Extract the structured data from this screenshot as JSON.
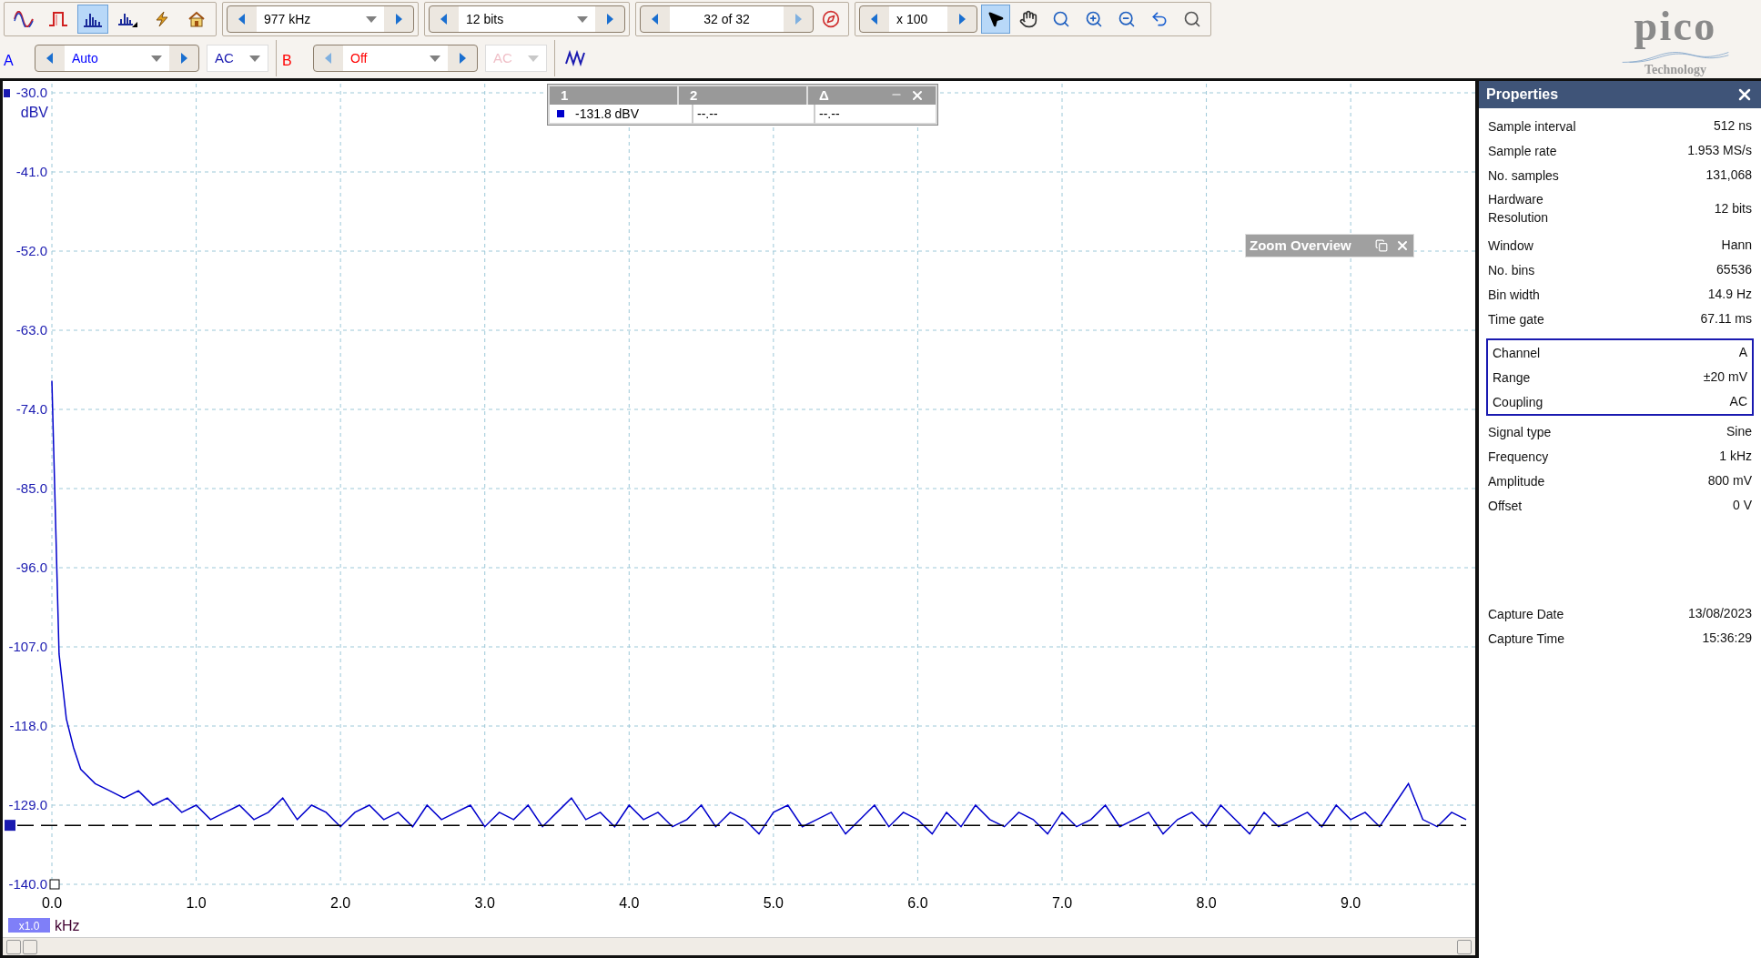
{
  "toolbar": {
    "mode_buttons": [
      {
        "kind": "scope",
        "selected": false
      },
      {
        "kind": "persistence",
        "selected": false
      },
      {
        "kind": "spectrum",
        "selected": true
      },
      {
        "kind": "spectrum_options",
        "selected": false
      },
      {
        "kind": "triggers",
        "selected": false
      },
      {
        "kind": "home",
        "selected": false
      }
    ],
    "collection": {
      "value": "977 kHz"
    },
    "resolution": {
      "value": "12 bits"
    },
    "buffer": {
      "value": "32 of 32"
    },
    "zoom": {
      "value": "x 100"
    },
    "tools": [
      {
        "kind": "pointer",
        "selected": true
      },
      {
        "kind": "hand",
        "selected": false
      },
      {
        "kind": "zoom_area",
        "selected": false
      },
      {
        "kind": "zoom_in",
        "selected": false
      },
      {
        "kind": "zoom_out",
        "selected": false
      },
      {
        "kind": "undo",
        "selected": false
      },
      {
        "kind": "zoom_100",
        "selected": false
      }
    ]
  },
  "channels": [
    {
      "label": "A",
      "range": "Auto",
      "coupling": "AC",
      "enabled": true,
      "color": "#0000ff"
    },
    {
      "label": "B",
      "range": "Off",
      "coupling": "AC",
      "enabled": false,
      "color": "#ff0000"
    }
  ],
  "logo": {
    "name": "pico",
    "tagline": "Technology"
  },
  "graph": {
    "y_unit": "dBV",
    "x_unit": "kHz",
    "x_scale": "x1.0",
    "chart_data": {
      "type": "line",
      "grid": true,
      "ref_lines": [
        {
          "axis": "y",
          "value": -131.8
        }
      ],
      "xlim": [
        0,
        9.8
      ],
      "ylim": [
        -140,
        -30
      ],
      "xticks": [
        {
          "value": 0,
          "label": "0.0"
        },
        {
          "value": 1,
          "label": "1.0"
        },
        {
          "value": 2,
          "label": "2.0"
        },
        {
          "value": 3,
          "label": "3.0"
        },
        {
          "value": 4,
          "label": "4.0"
        },
        {
          "value": 5,
          "label": "5.0"
        },
        {
          "value": 6,
          "label": "6.0"
        },
        {
          "value": 7,
          "label": "7.0"
        },
        {
          "value": 8,
          "label": "8.0"
        },
        {
          "value": 9,
          "label": "9.0"
        }
      ],
      "yticks": [
        {
          "value": -30,
          "label": "-30.0"
        },
        {
          "value": -41,
          "label": "-41.0"
        },
        {
          "value": -52,
          "label": "-52.0"
        },
        {
          "value": -63,
          "label": "-63.0"
        },
        {
          "value": -74,
          "label": "-74.0"
        },
        {
          "value": -85,
          "label": "-85.0"
        },
        {
          "value": -96,
          "label": "-96.0"
        },
        {
          "value": -107,
          "label": "-107.0"
        },
        {
          "value": -118,
          "label": "-118.0"
        },
        {
          "value": -129,
          "label": "-129.0"
        },
        {
          "value": -140,
          "label": "-140.0"
        }
      ],
      "x": [
        0,
        0.05,
        0.1,
        0.15,
        0.2,
        0.3,
        0.4,
        0.5,
        0.6,
        0.7,
        0.8,
        0.9,
        1.0,
        1.1,
        1.2,
        1.3,
        1.4,
        1.5,
        1.6,
        1.7,
        1.8,
        1.9,
        2.0,
        2.1,
        2.2,
        2.3,
        2.4,
        2.5,
        2.6,
        2.7,
        2.8,
        2.9,
        3.0,
        3.1,
        3.2,
        3.3,
        3.4,
        3.5,
        3.6,
        3.7,
        3.8,
        3.9,
        4.0,
        4.1,
        4.2,
        4.3,
        4.4,
        4.5,
        4.6,
        4.7,
        4.8,
        4.9,
        5.0,
        5.1,
        5.2,
        5.3,
        5.4,
        5.5,
        5.6,
        5.7,
        5.8,
        5.9,
        6.0,
        6.1,
        6.2,
        6.3,
        6.4,
        6.5,
        6.6,
        6.7,
        6.8,
        6.9,
        7.0,
        7.1,
        7.2,
        7.3,
        7.4,
        7.5,
        7.6,
        7.7,
        7.8,
        7.9,
        8.0,
        8.1,
        8.2,
        8.3,
        8.4,
        8.5,
        8.6,
        8.7,
        8.8,
        8.9,
        9.0,
        9.1,
        9.2,
        9.3,
        9.4,
        9.5,
        9.6,
        9.7,
        9.8
      ],
      "series": [
        {
          "color": "#0000cc",
          "values": [
            -70,
            -108,
            -117,
            -121,
            -124,
            -126,
            -127,
            -128,
            -127,
            -129,
            -128,
            -130,
            -129,
            -131,
            -130,
            -129,
            -131,
            -130,
            -128,
            -131,
            -129,
            -130,
            -132,
            -130,
            -129,
            -131,
            -130,
            -132,
            -129,
            -131,
            -130,
            -129,
            -132,
            -130,
            -131,
            -129,
            -132,
            -130,
            -128,
            -131,
            -130,
            -132,
            -129,
            -131,
            -130,
            -132,
            -131,
            -129,
            -132,
            -130,
            -131,
            -133,
            -130,
            -129,
            -132,
            -131,
            -130,
            -133,
            -131,
            -129,
            -132,
            -130,
            -131,
            -133,
            -130,
            -132,
            -129,
            -131,
            -132,
            -130,
            -131,
            -133,
            -130,
            -132,
            -131,
            -129,
            -132,
            -131,
            -130,
            -133,
            -131,
            -130,
            -132,
            -129,
            -131,
            -133,
            -130,
            -132,
            -131,
            -130,
            -132,
            -129,
            -131,
            -130,
            -132,
            -129,
            -126,
            -131,
            -132,
            -130,
            -131
          ]
        }
      ]
    }
  },
  "rulers": {
    "columns": [
      "1",
      "2",
      "Δ"
    ],
    "values": [
      "-131.8 dBV",
      "--.--",
      "--.--"
    ]
  },
  "zoom_overview": {
    "title": "Zoom Overview"
  },
  "properties": {
    "title": "Properties",
    "groups": [
      {
        "kind": "plain",
        "rows": [
          {
            "label": "Sample interval",
            "value": "512 ns"
          },
          {
            "label": "Sample rate",
            "value": "1.953 MS/s"
          },
          {
            "label": "No. samples",
            "value": "131,068"
          },
          {
            "label": "Hardware Resolution",
            "value": "12 bits"
          }
        ]
      },
      {
        "kind": "plain",
        "rows": [
          {
            "label": "Window",
            "value": "Hann"
          },
          {
            "label": "No. bins",
            "value": "65536"
          },
          {
            "label": "Bin width",
            "value": "14.9 Hz"
          },
          {
            "label": "Time gate",
            "value": "67.11 ms"
          }
        ]
      },
      {
        "kind": "boxed",
        "rows": [
          {
            "label": "Channel",
            "value": "A"
          },
          {
            "label": "Range",
            "value": "±20 mV"
          },
          {
            "label": "Coupling",
            "value": "AC"
          }
        ]
      },
      {
        "kind": "plain",
        "rows": [
          {
            "label": "Signal type",
            "value": "Sine"
          },
          {
            "label": "Frequency",
            "value": "1 kHz"
          },
          {
            "label": "Amplitude",
            "value": "800 mV"
          },
          {
            "label": "Offset",
            "value": "0 V"
          }
        ]
      },
      {
        "kind": "plain",
        "rows": [
          {
            "label": "Capture Date",
            "value": "13/08/2023"
          },
          {
            "label": "Capture Time",
            "value": "15:36:29"
          }
        ]
      }
    ]
  }
}
